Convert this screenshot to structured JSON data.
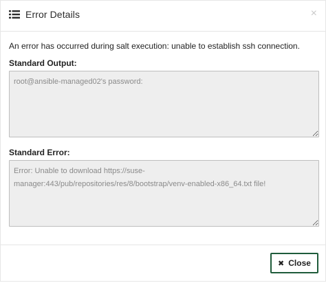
{
  "dialog": {
    "title": "Error Details",
    "title_icon": "list-icon",
    "dismiss_glyph": "×"
  },
  "body": {
    "message": "An error has occurred during salt execution: unable to establish ssh connection.",
    "stdout_label": "Standard Output:",
    "stdout_value": "root@ansible-managed02's password:",
    "stderr_label": "Standard Error:",
    "stderr_value": "Error: Unable to download https://suse-manager:443/pub/repositories/res/8/bootstrap/venv-enabled-x86_64.txt file!"
  },
  "footer": {
    "close_label": "Close",
    "close_icon": "close-icon",
    "close_glyph": "✖"
  },
  "colors": {
    "button_border": "#1e5b3a",
    "textarea_bg": "#eeeeee"
  }
}
